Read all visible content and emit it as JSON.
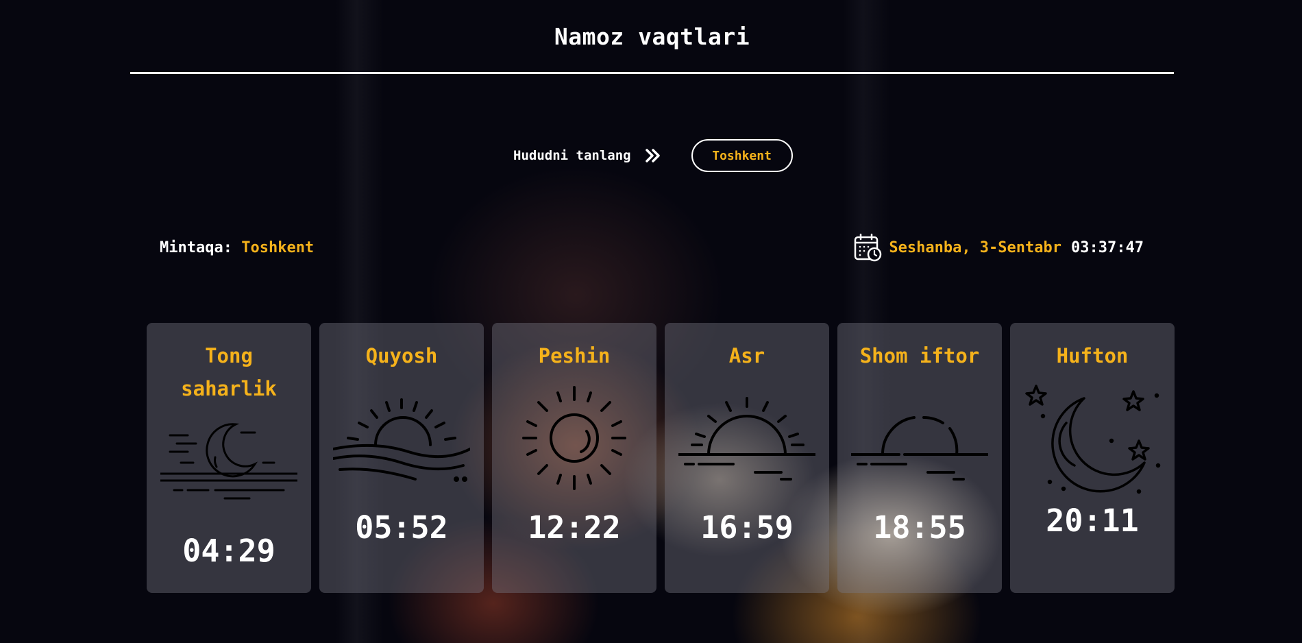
{
  "header": {
    "title": "Namoz vaqtlari"
  },
  "region_select": {
    "label": "Hududni tanlang",
    "button_label": "Toshkent",
    "arrow_icon": "double-chevron-right-icon"
  },
  "info": {
    "region_label": "Mintaqa:",
    "region_value": "Toshkent",
    "calendar_icon": "calendar-clock-icon",
    "date": "Seshanba, 3-Sentabr",
    "time": "03:37:47"
  },
  "colors": {
    "accent": "#f5b21b",
    "background": "#06060f",
    "text": "#ffffff"
  },
  "prayers": [
    {
      "name": "Tong saharlik",
      "time": "04:29",
      "icon": "moon-over-water-icon"
    },
    {
      "name": "Quyosh",
      "time": "05:52",
      "icon": "sunrise-over-hills-icon"
    },
    {
      "name": "Peshin",
      "time": "12:22",
      "icon": "sun-icon"
    },
    {
      "name": "Asr",
      "time": "16:59",
      "icon": "sun-setting-icon"
    },
    {
      "name": "Shom iftor",
      "time": "18:55",
      "icon": "sunset-horizon-icon"
    },
    {
      "name": "Hufton",
      "time": "20:11",
      "icon": "crescent-moon-stars-icon"
    }
  ]
}
